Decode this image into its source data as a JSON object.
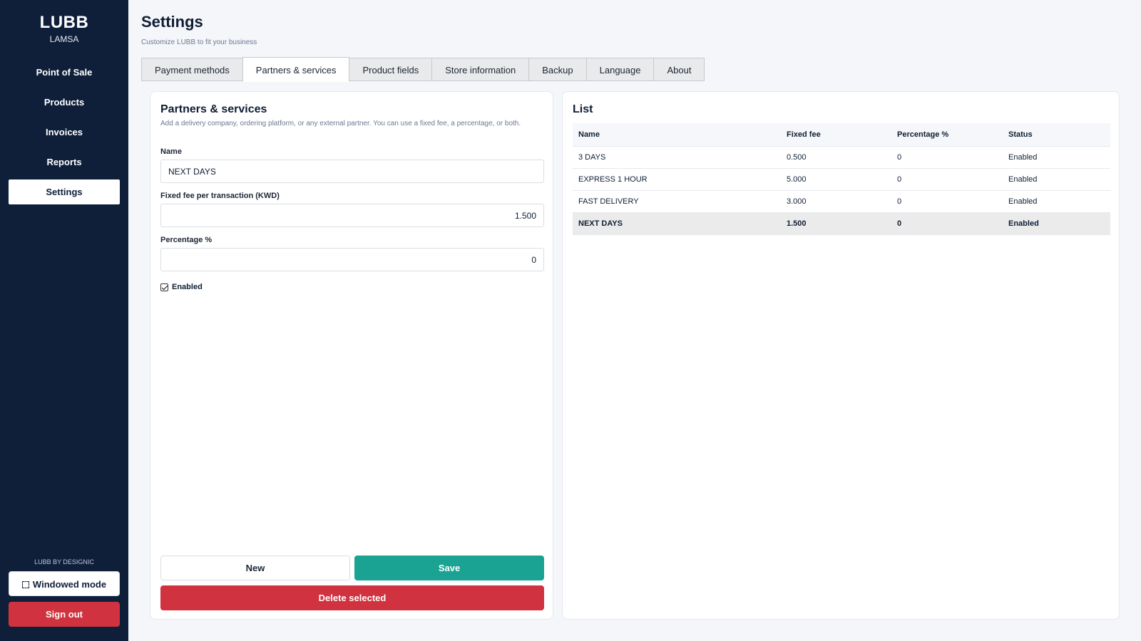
{
  "brand": {
    "title": "LUBB",
    "subtitle": "LAMSA"
  },
  "sidebar": {
    "items": [
      {
        "label": "Point of Sale"
      },
      {
        "label": "Products"
      },
      {
        "label": "Invoices"
      },
      {
        "label": "Reports"
      },
      {
        "label": "Settings",
        "active": true
      }
    ],
    "credit": "LUBB BY DESIGNIC",
    "windowed_label": "Windowed mode",
    "signout_label": "Sign out"
  },
  "header": {
    "title": "Settings",
    "subtitle": "Customize LUBB to fit your business"
  },
  "tabs": [
    {
      "label": "Payment methods"
    },
    {
      "label": "Partners & services",
      "active": true
    },
    {
      "label": "Product fields"
    },
    {
      "label": "Store information"
    },
    {
      "label": "Backup"
    },
    {
      "label": "Language"
    },
    {
      "label": "About"
    }
  ],
  "form": {
    "title": "Partners & services",
    "description": "Add a delivery company, ordering platform, or any external partner. You can use a fixed fee, a percentage, or both.",
    "name_label": "Name",
    "name_value": "NEXT DAYS",
    "fee_label": "Fixed fee per transaction (KWD)",
    "fee_value": "1.500",
    "pct_label": "Percentage %",
    "pct_value": "0",
    "enabled_label": "Enabled",
    "enabled": true,
    "new_label": "New",
    "save_label": "Save",
    "delete_label": "Delete selected"
  },
  "list": {
    "title": "List",
    "columns": [
      "Name",
      "Fixed fee",
      "Percentage %",
      "Status"
    ],
    "rows": [
      {
        "name": "3 DAYS",
        "fee": "0.500",
        "pct": "0",
        "status": "Enabled"
      },
      {
        "name": "EXPRESS 1 HOUR",
        "fee": "5.000",
        "pct": "0",
        "status": "Enabled"
      },
      {
        "name": "FAST DELIVERY",
        "fee": "3.000",
        "pct": "0",
        "status": "Enabled"
      },
      {
        "name": "NEXT DAYS",
        "fee": "1.500",
        "pct": "0",
        "status": "Enabled",
        "selected": true
      }
    ]
  },
  "colors": {
    "sidebar": "#0f1f3a",
    "save": "#1aa393",
    "danger": "#d1323f"
  }
}
